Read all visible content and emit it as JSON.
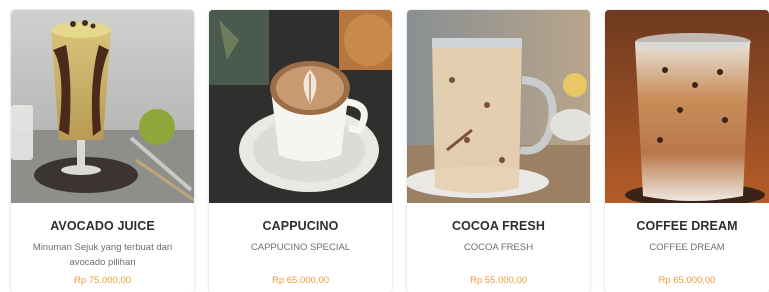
{
  "products": [
    {
      "image": "avocado-juice-photo",
      "name": "AVOCADO JUICE",
      "description": "Minuman Sejuk yang terbuat dari avocado pilihan",
      "price": "Rp 75.000,00"
    },
    {
      "image": "cappuccino-photo",
      "name": "CAPPUCINO",
      "description": "CAPPUCINO SPECIAL",
      "price": "Rp 65.000,00"
    },
    {
      "image": "cocoa-fresh-photo",
      "name": "COCOA FRESH",
      "description": "COCOA FRESH",
      "price": "Rp 55.000,00"
    },
    {
      "image": "coffee-dream-photo",
      "name": "COFFEE DREAM",
      "description": "COFFEE DREAM",
      "price": "Rp 65.000,00"
    }
  ],
  "colors": {
    "price": "#f29a3a",
    "title": "#2b2f33",
    "description": "#6b6f75"
  }
}
